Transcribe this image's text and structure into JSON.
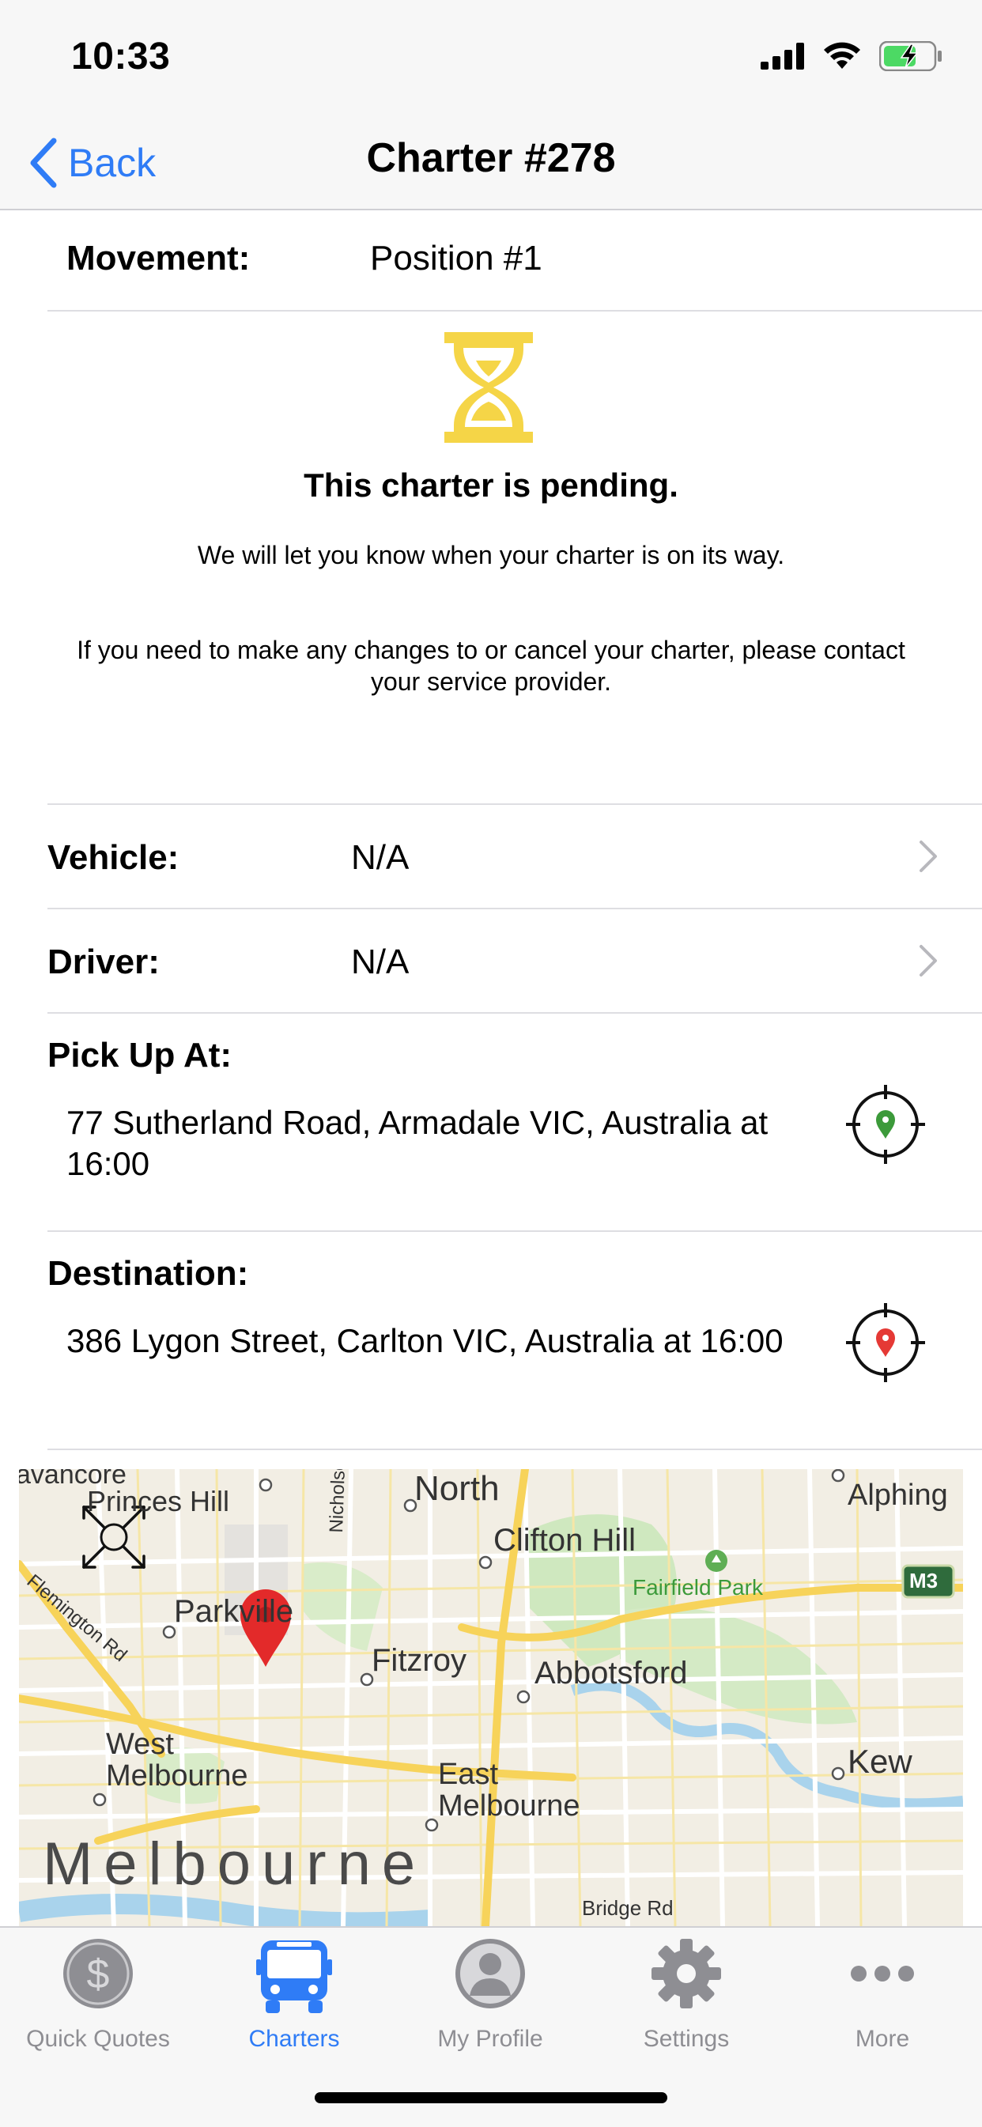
{
  "status_bar": {
    "time": "10:33"
  },
  "nav": {
    "back_label": "Back",
    "title": "Charter #278"
  },
  "movement": {
    "label": "Movement:",
    "value": "Position #1"
  },
  "pending": {
    "title": "This charter is pending.",
    "line1": "We will let you know when your charter is on its way.",
    "line2": "If you need to make any changes to or cancel your charter, please contact your service provider."
  },
  "vehicle": {
    "label": "Vehicle:",
    "value": "N/A"
  },
  "driver": {
    "label": "Driver:",
    "value": "N/A"
  },
  "pickup": {
    "label": "Pick Up At:",
    "address": "77 Sutherland Road, Armadale VIC, Australia at 16:00"
  },
  "destination": {
    "label": "Destination:",
    "address": "386 Lygon Street, Carlton VIC, Australia at 16:00"
  },
  "map": {
    "labels": {
      "north": "North",
      "alphington": "Alphing",
      "princes_hill": "Princes Hill",
      "clifton_hill": "Clifton Hill",
      "nicholson": "Nicholson St",
      "fairfield": "Fairfield Park",
      "m3": "M3",
      "parkville": "Parkville",
      "flemington": "Flemington Rd",
      "fitzroy": "Fitzroy",
      "abbotsford": "Abbotsford",
      "west_melbourne": "West\nMelbourne",
      "east_melbourne": "East\nMelbourne",
      "kew": "Kew",
      "melbourne": "Melbourne",
      "bridge_rd": "Bridge Rd",
      "avancore": "avancore"
    }
  },
  "colors": {
    "accent": "#2f7cf6",
    "pending_yellow": "#f5d547",
    "pin_green": "#3c9a3a",
    "pin_red": "#e53935"
  },
  "tabs": [
    {
      "label": "Quick Quotes",
      "icon": "dollar-circle-icon"
    },
    {
      "label": "Charters",
      "icon": "bus-icon"
    },
    {
      "label": "My Profile",
      "icon": "profile-icon"
    },
    {
      "label": "Settings",
      "icon": "gear-icon"
    },
    {
      "label": "More",
      "icon": "more-dots-icon"
    }
  ]
}
